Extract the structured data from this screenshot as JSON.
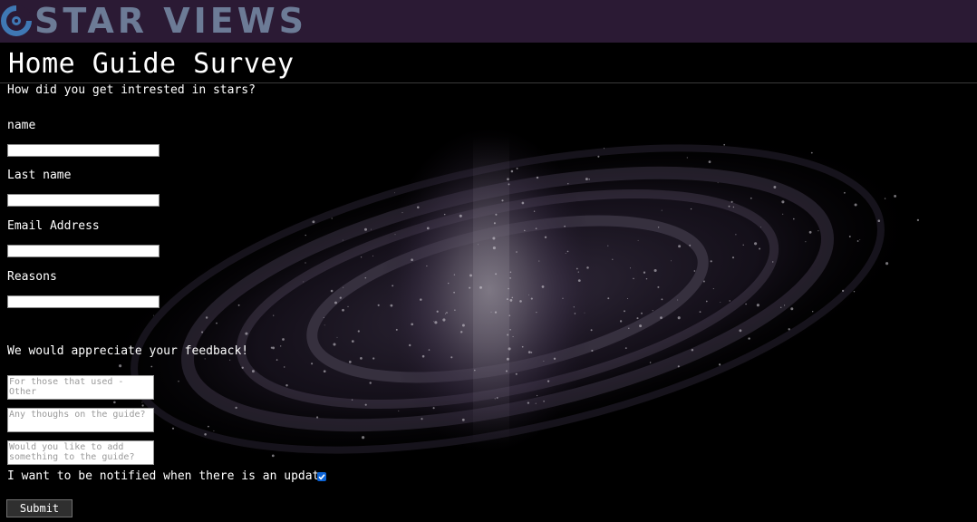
{
  "header": {
    "brand": "STAR VIEWS",
    "logo_icon": "swirl-logo-icon",
    "background_color": "#2b1a34",
    "brand_color": "#6c7b96"
  },
  "page": {
    "title": "Home Guide Survey",
    "intro": "How did you get intrested in stars?"
  },
  "form": {
    "fields": [
      {
        "label": "name",
        "value": "",
        "placeholder": ""
      },
      {
        "label": "Last name",
        "value": "",
        "placeholder": ""
      },
      {
        "label": "Email Address",
        "value": "",
        "placeholder": ""
      },
      {
        "label": "Reasons",
        "value": "",
        "placeholder": ""
      }
    ],
    "feedback_heading": "We would appreciate your feedback!",
    "textareas": [
      {
        "placeholder": "For those that used - Other",
        "value": ""
      },
      {
        "placeholder": "Any thoughs on the guide?",
        "value": ""
      },
      {
        "placeholder": "Would you like to add something to the guide?",
        "value": ""
      }
    ],
    "notify_label": "I want to be notified when there is an update",
    "notify_checked": true,
    "submit_label": "Submit"
  },
  "colors": {
    "accent": "#0b63d6",
    "page_background": "#000000"
  }
}
